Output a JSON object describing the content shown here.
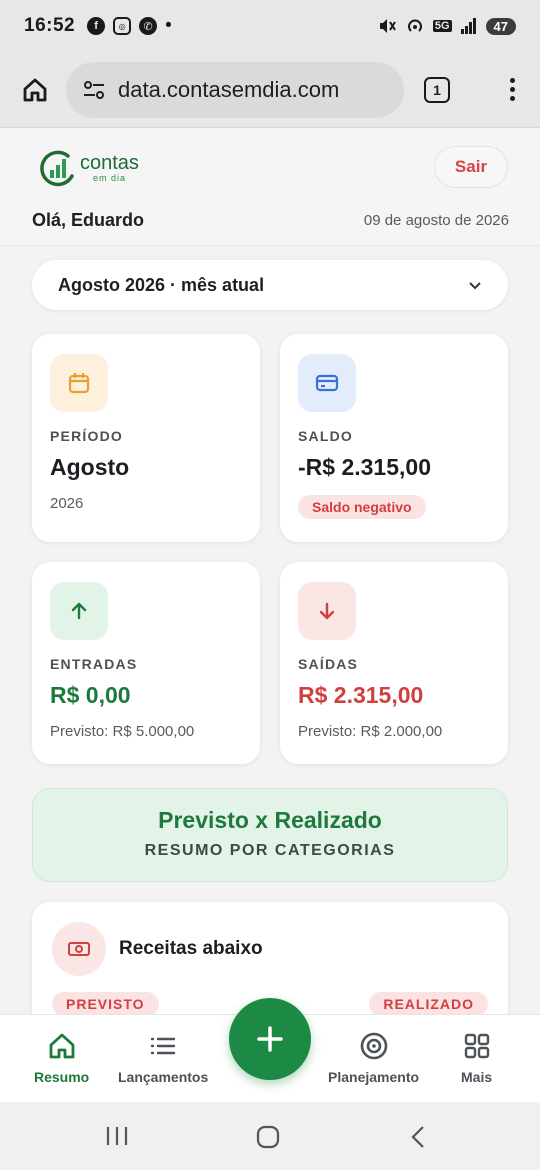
{
  "status_bar": {
    "time": "16:52",
    "network": "5G",
    "battery": "47",
    "dot": "•"
  },
  "browser": {
    "url": "data.contasemdia.com",
    "tab_count": "1"
  },
  "header": {
    "logo_brand": "contas",
    "logo_sub": "em dia",
    "logout_label": "Sair",
    "greeting": "Olá, Eduardo",
    "date": "09 de agosto de 2026"
  },
  "month_selector": {
    "value": "Agosto 2026 · mês atual"
  },
  "cards": {
    "periodo": {
      "label": "PERÍODO",
      "value": "Agosto",
      "sub": "2026",
      "icon": "calendar-icon",
      "color": "#e7a12a"
    },
    "saldo": {
      "label": "SALDO",
      "value": "-R$ 2.315,00",
      "badge": "Saldo negativo",
      "icon": "credit-card-icon",
      "color": "#3b6fd4"
    },
    "entradas": {
      "label": "ENTRADAS",
      "value": "R$ 0,00",
      "sub": "Previsto: R$ 5.000,00",
      "icon": "arrow-up-icon",
      "color": "#1d7a3c"
    },
    "saidas": {
      "label": "SAÍDAS",
      "value": "R$ 2.315,00",
      "sub": "Previsto: R$ 2.000,00",
      "icon": "arrow-down-icon",
      "color": "#d23f3f"
    }
  },
  "previsto_realizado": {
    "title": "Previsto x Realizado",
    "subtitle": "RESUMO POR CATEGORIAS"
  },
  "receitas": {
    "title": "Receitas abaixo",
    "previsto_label": "PREVISTO",
    "realizado_label": "REALIZADO"
  },
  "bottom_nav": {
    "items": [
      {
        "label": "Resumo",
        "icon": "home-icon"
      },
      {
        "label": "Lançamentos",
        "icon": "list-icon"
      },
      {
        "label": "Planejamento",
        "icon": "target-icon"
      },
      {
        "label": "Mais",
        "icon": "grid-icon"
      }
    ],
    "fab_icon": "plus-icon"
  }
}
